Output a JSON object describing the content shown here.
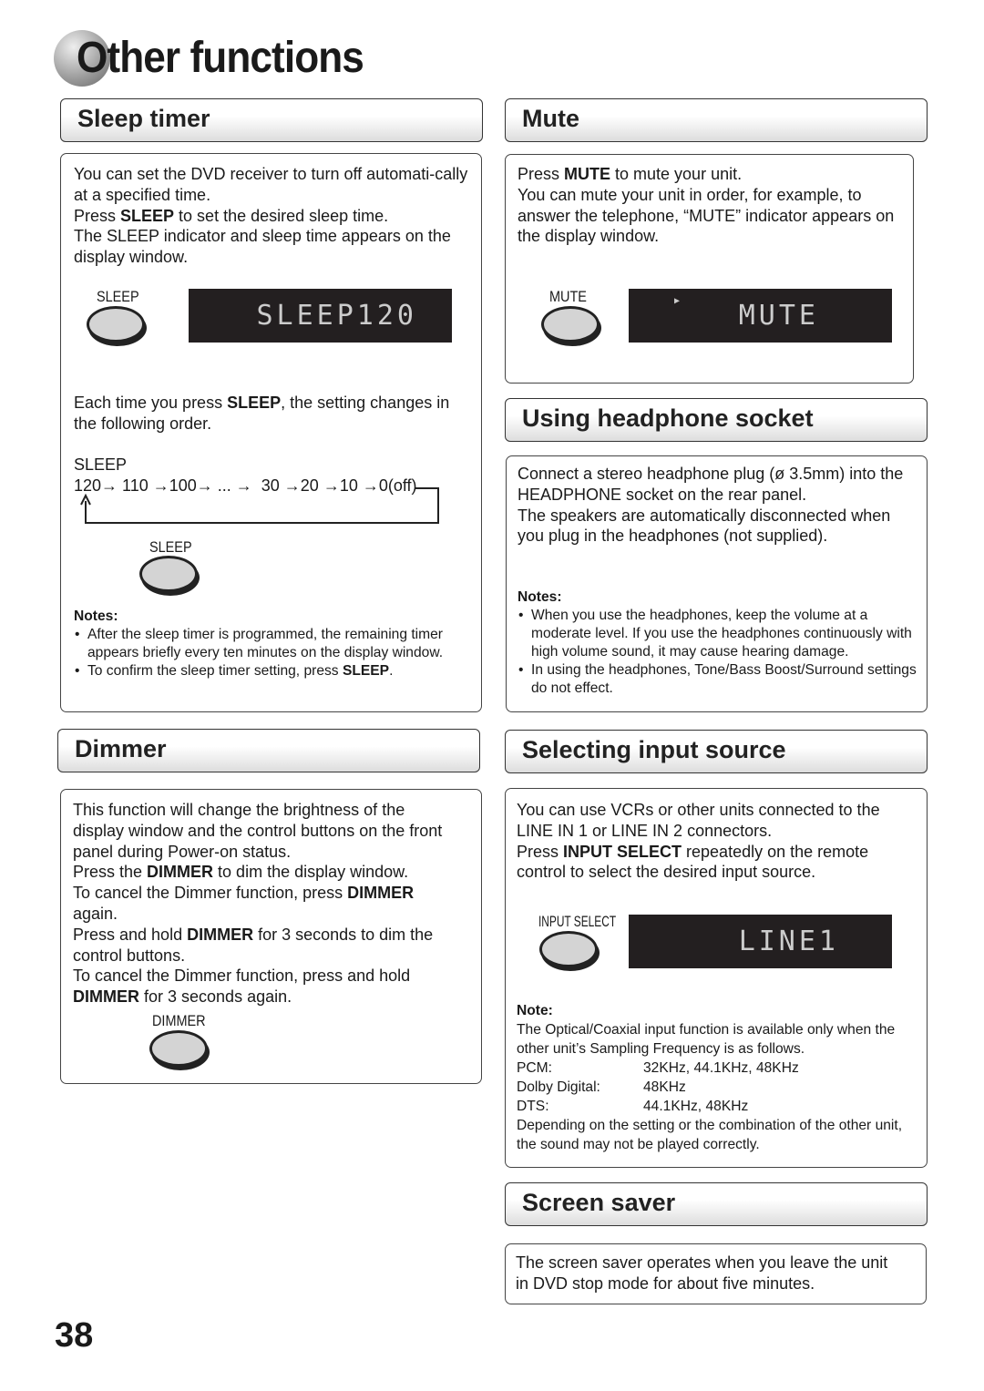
{
  "page": {
    "title": "Other functions",
    "number": "38"
  },
  "sleep": {
    "header": "Sleep timer",
    "p1": "You can set the DVD receiver to turn off automati-cally at a specified time.",
    "p2a": "Press ",
    "p2b": "SLEEP",
    "p2c": " to set the desired sleep time.",
    "p3": "The SLEEP indicator and sleep time appears on the display window.",
    "button_label": "SLEEP",
    "display": "SLEEP120",
    "p4a": "Each time you press ",
    "p4b": "SLEEP",
    "p4c": ", the setting changes in the following order.",
    "seq_label": "SLEEP",
    "sequence": "120→ 110 →100→ ... →  30 →20 →10 →0(off)",
    "button_label2": "SLEEP",
    "notes_title": "Notes:",
    "note1": "After the sleep timer is programmed, the remaining timer appears briefly every ten minutes on the display window.",
    "note2a": "To confirm the sleep timer setting, press ",
    "note2b": "SLEEP",
    "note2c": "."
  },
  "mute": {
    "header": "Mute",
    "p1a": "Press ",
    "p1b": "MUTE",
    "p1c": " to mute your unit.",
    "p2": "You can mute your unit in order, for example, to answer the telephone, “MUTE” indicator appears on the display window.",
    "button_label": "MUTE",
    "display": "MUTE"
  },
  "headphone": {
    "header": "Using headphone socket",
    "p1": "Connect a stereo headphone plug (ø 3.5mm) into the HEADPHONE socket on the rear panel.",
    "p2": "The speakers are automatically disconnected when you plug in the headphones (not supplied).",
    "notes_title": "Notes:",
    "note1": "When you use the headphones, keep the volume at a moderate level. If you use the headphones continuously with high volume sound, it may cause hearing damage.",
    "note2": "In using the headphones, Tone/Bass Boost/Surround settings do not effect."
  },
  "dimmer": {
    "header": "Dimmer",
    "p1": "This function will change the brightness of the display window and the control buttons on the front panel during Power-on status.",
    "p2a": "Press the ",
    "p2b": "DIMMER",
    "p2c": " to dim the display window.",
    "p3a": "To cancel the Dimmer function, press ",
    "p3b": "DIMMER",
    "p3c": " again.",
    "p4a": "Press and hold ",
    "p4b": "DIMMER",
    "p4c": " for 3 seconds to dim the control buttons.",
    "p5": "To cancel the Dimmer function, press and hold ",
    "p5b": "DIMMER",
    "p5c": " for 3 seconds again.",
    "button_label": "DIMMER"
  },
  "input": {
    "header": "Selecting input source",
    "p1": "You can use VCRs or other units connected to the LINE IN 1 or LINE IN 2 connectors.",
    "p2a": "Press ",
    "p2b": "INPUT SELECT",
    "p2c": " repeatedly on the remote control to select the desired input source.",
    "button_label": "INPUT SELECT",
    "display": "LINE1",
    "note_title": "Note:",
    "note1": "The Optical/Coaxial input function is available only when the other unit’s Sampling Frequency is as follows.",
    "rates": [
      {
        "format": "PCM:",
        "freq": "32KHz, 44.1KHz, 48KHz"
      },
      {
        "format": "Dolby Digital:",
        "freq": "48KHz"
      },
      {
        "format": "DTS:",
        "freq": "44.1KHz, 48KHz"
      }
    ],
    "note2": "Depending on the setting or the combination of the other unit, the sound may not be played correctly."
  },
  "screensaver": {
    "header": "Screen saver",
    "p1": "The screen saver operates when you leave the unit in DVD stop mode for about five minutes."
  }
}
